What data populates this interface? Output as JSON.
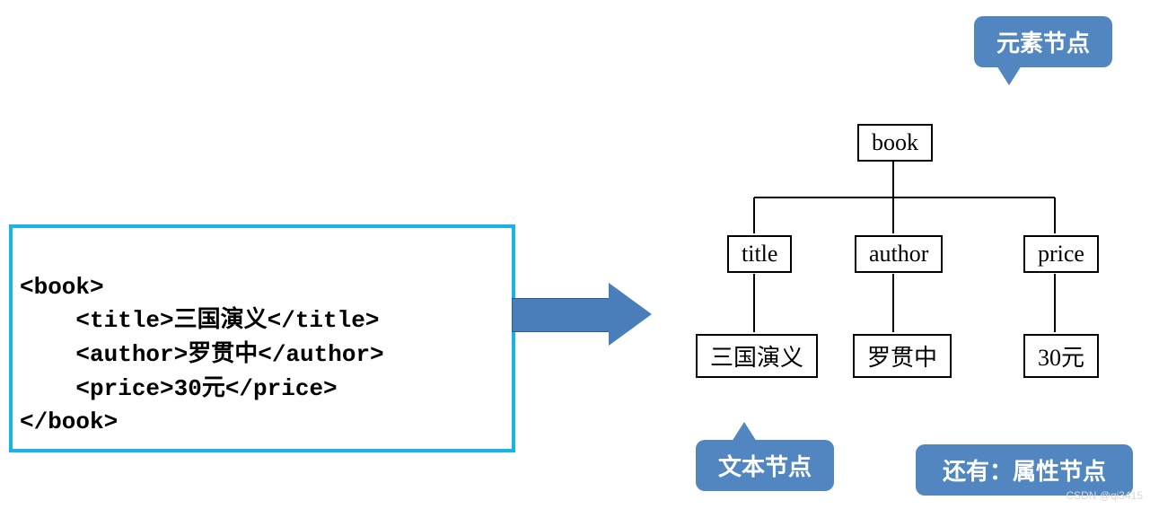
{
  "code": {
    "lines": [
      "<book>",
      "    <title>三国演义</title>",
      "    <author>罗贯中</author>",
      "    <price>30元</price>",
      "</book>"
    ]
  },
  "tree": {
    "root": "book",
    "children": [
      {
        "label": "title",
        "value": "三国演义"
      },
      {
        "label": "author",
        "value": "罗贯中"
      },
      {
        "label": "price",
        "value": "30元"
      }
    ]
  },
  "callouts": {
    "element_node": "元素节点",
    "text_node": "文本节点",
    "attribute_note": "还有：属性节点"
  },
  "watermark": "CSDN @qi3415"
}
